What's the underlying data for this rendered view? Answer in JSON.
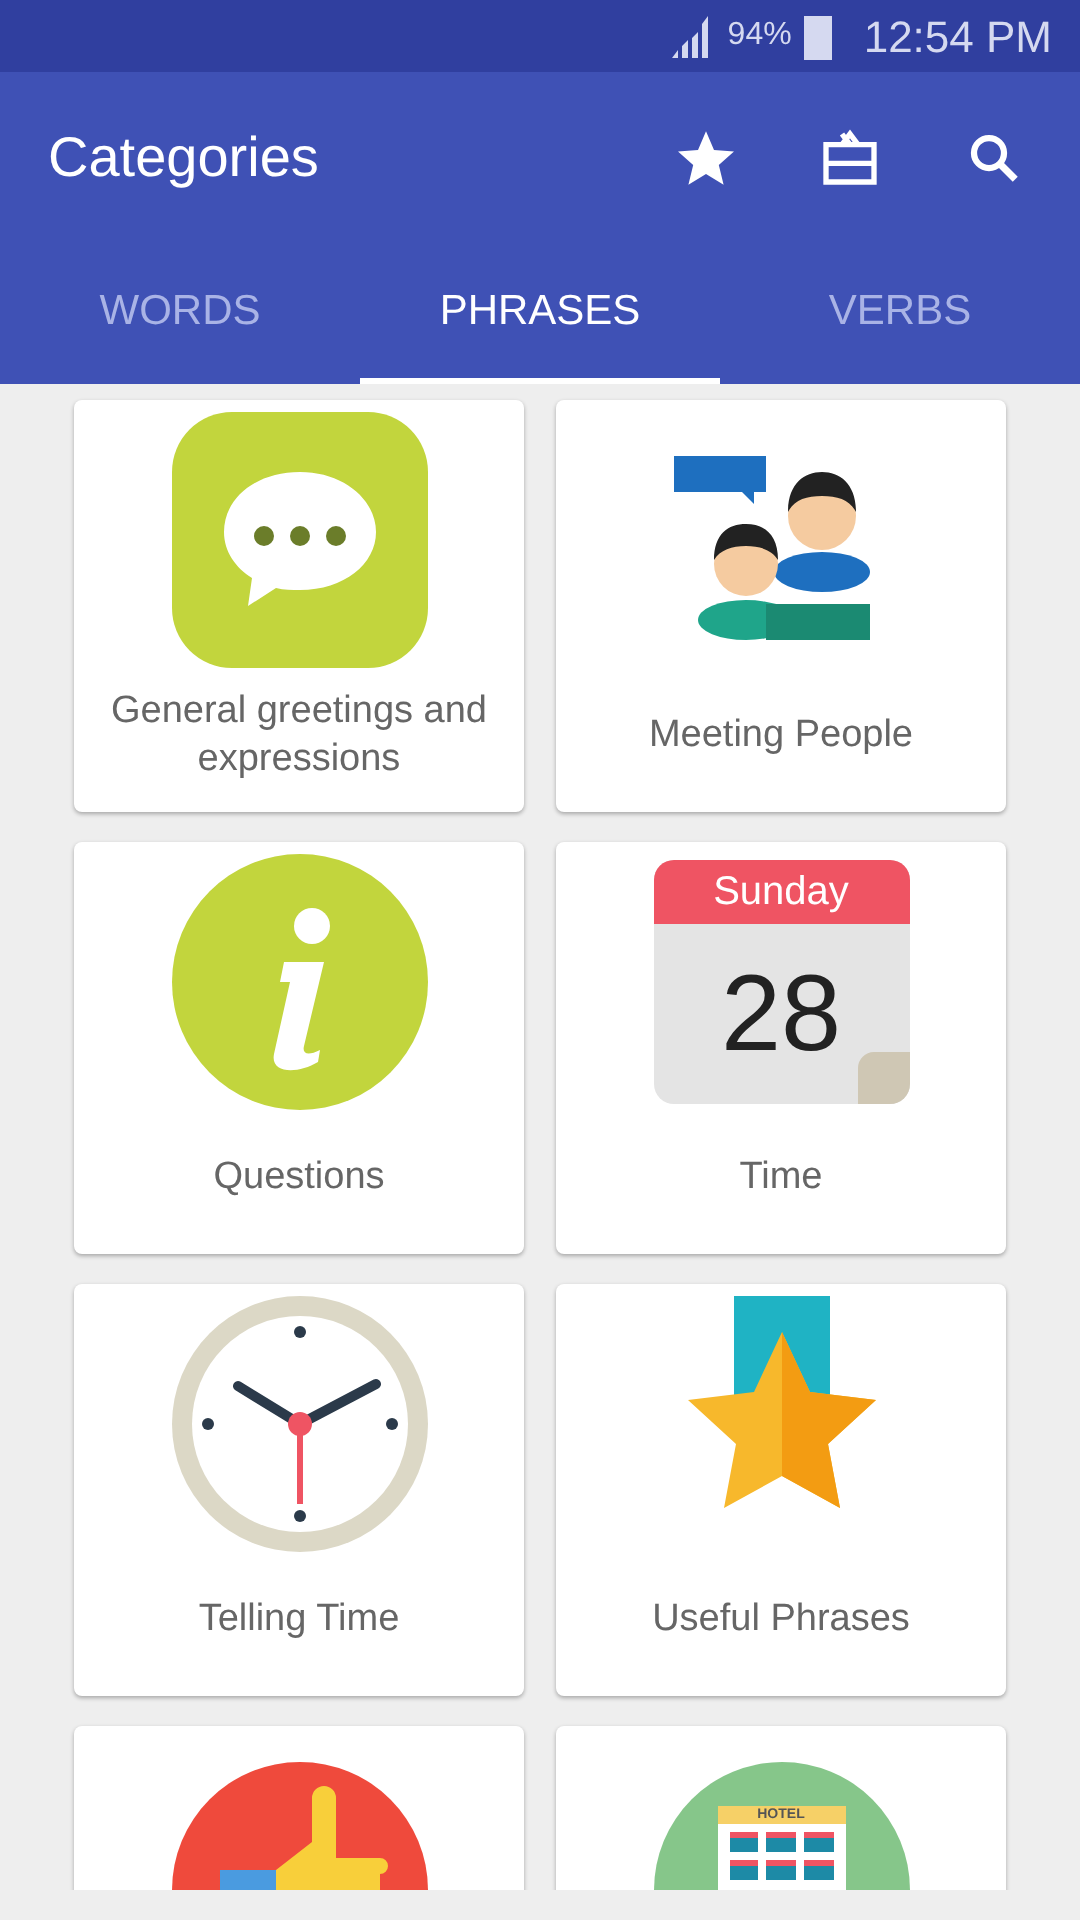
{
  "status_bar": {
    "battery": "94%",
    "time": "12:54 PM"
  },
  "app_bar": {
    "title": "Categories"
  },
  "tabs": [
    {
      "label": "WORDS",
      "selected": false
    },
    {
      "label": "PHRASES",
      "selected": true
    },
    {
      "label": "VERBS",
      "selected": false
    }
  ],
  "categories": [
    {
      "kind": "chat",
      "label": "General greetings and expressions"
    },
    {
      "kind": "people",
      "label": "Meeting People"
    },
    {
      "kind": "info",
      "label": "Questions"
    },
    {
      "kind": "calendar",
      "label": "Time"
    },
    {
      "kind": "clock",
      "label": "Telling Time"
    },
    {
      "kind": "medal",
      "label": "Useful Phrases"
    },
    {
      "kind": "thumb"
    },
    {
      "kind": "hotel",
      "sign": "HOTEL"
    }
  ],
  "calendar_icon": {
    "weekday": "Sunday",
    "day": "28"
  }
}
